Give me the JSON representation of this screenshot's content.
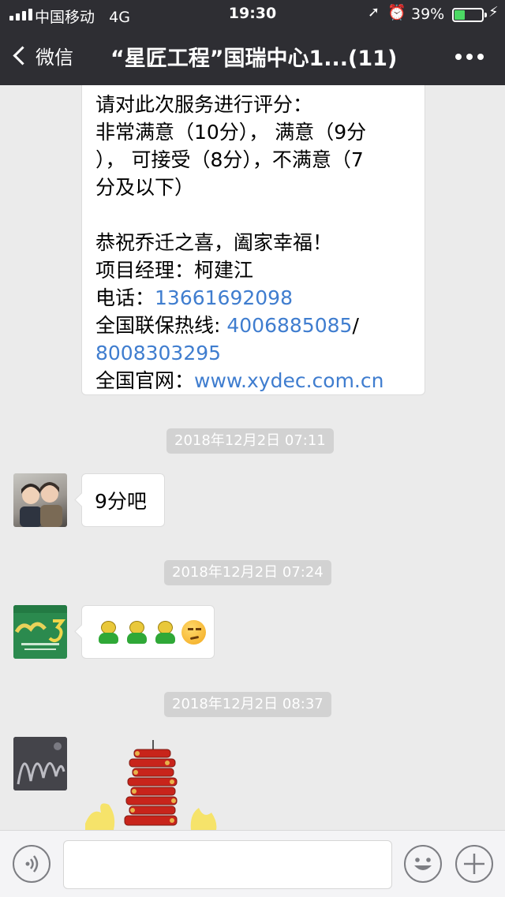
{
  "status_bar": {
    "carrier": "中国移动",
    "network": "4G",
    "time": "19:30",
    "battery_percent": "39%",
    "battery_level": 0.39
  },
  "nav": {
    "back_label": "微信",
    "title": "“星匠工程”国瑞中心1...(11)"
  },
  "messages": {
    "long": {
      "lines": [
        "请对此次服务进行评分：",
        "非常满意（10分），  满意（9分",
        "），  可接受（8分），不满意（7",
        "分及以下）"
      ],
      "greeting": "恭祝乔迁之喜，阖家幸福！",
      "manager": "项目经理：柯建江",
      "phone_label": "电话：",
      "phone": "13661692098",
      "hotline_label": "全国联保热线: ",
      "hotline1": "4006885085",
      "hotline_sep": "/",
      "hotline2": "8008303295",
      "site_label": "全国官网：",
      "site": "www.xydec.com.cn"
    },
    "ts1": "2018年12月2日 07:11",
    "reply1": "9分吧",
    "ts2": "2018年12月2日 07:24",
    "ts3": "2018年12月2日 08:37"
  },
  "icons": {
    "signal": "signal-bars-icon",
    "location": "location-arrow-icon",
    "alarm": "alarm-clock-icon",
    "battery": "battery-icon",
    "back": "chevron-left-icon",
    "more": "more-dots-icon",
    "voice": "voice-icon",
    "emoji": "emoji-icon",
    "plus": "plus-icon"
  },
  "colors": {
    "nav_bg": "#2e2e33",
    "chat_bg": "#ebebeb",
    "link": "#3f7dcf",
    "timestamp_bg": "#d2d2d2",
    "battery_fill": "#4cd964"
  }
}
